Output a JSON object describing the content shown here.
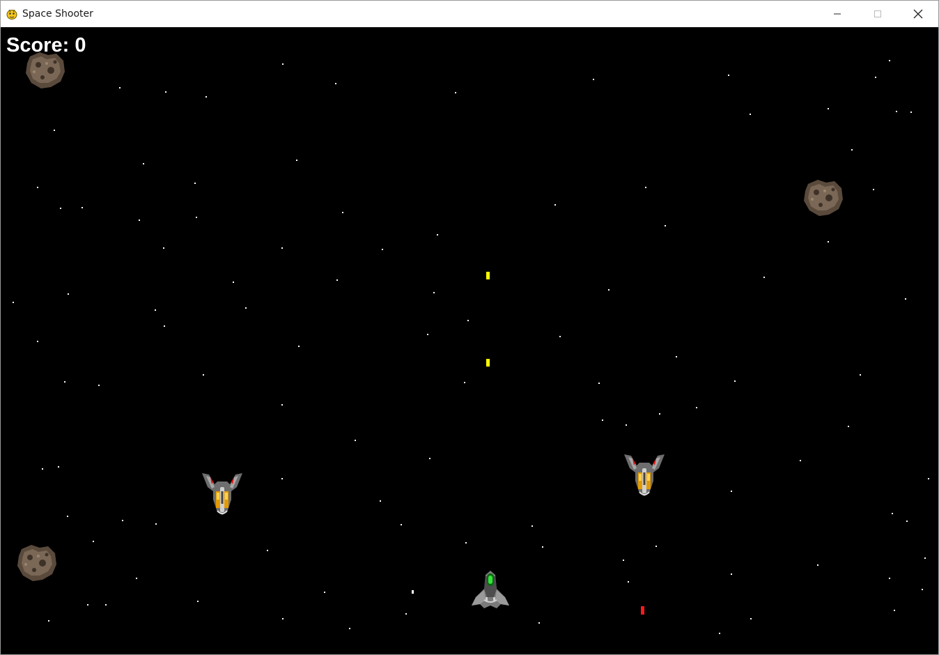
{
  "window": {
    "title": "Space Shooter",
    "icons": {
      "app": "pygame-snake-icon",
      "minimize": "minimize-icon",
      "maximize": "maximize-icon",
      "close": "close-icon"
    }
  },
  "hud": {
    "score_label": "Score: 0"
  },
  "game": {
    "background_color": "#000000",
    "player_bullet_color": "#FFFF00",
    "enemy_bullet_color": "#FF0000",
    "sprites": {
      "player": "player-ship",
      "enemy": "enemy-ship",
      "asteroid": "asteroid"
    }
  }
}
